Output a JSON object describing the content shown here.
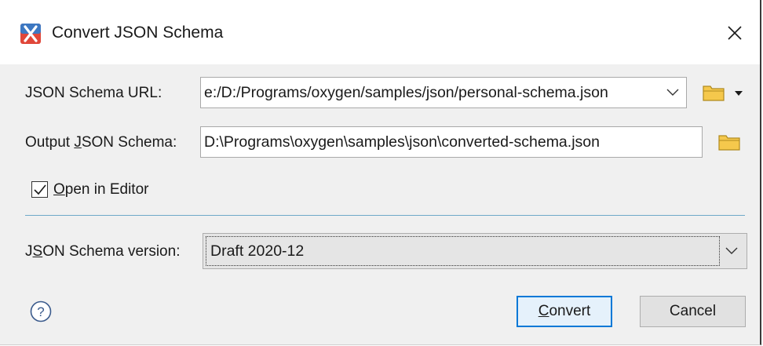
{
  "window": {
    "title": "Convert JSON Schema",
    "icon": "oxygen-x-icon",
    "close_icon": "close-icon"
  },
  "form": {
    "schema_url": {
      "label": "JSON Schema URL:",
      "value": "e:/D:/Programs/oxygen/samples/json/personal-schema.json"
    },
    "output": {
      "label_prefix": "Output ",
      "label_mnemonic": "J",
      "label_suffix": "SON Schema:",
      "value": "D:\\Programs\\oxygen\\samples\\json\\converted-schema.json"
    },
    "open_in_editor": {
      "label_mnemonic": "O",
      "label_rest": "pen in Editor",
      "checked": true
    },
    "version": {
      "label_prefix": "J",
      "label_mnemonic": "S",
      "label_suffix": "ON Schema version:",
      "selected": "Draft 2020-12"
    }
  },
  "buttons": {
    "convert_mnemonic": "C",
    "convert_rest": "onvert",
    "cancel": "Cancel"
  },
  "colors": {
    "accent": "#0078d7",
    "folder": "#f5c84c",
    "separator": "#6fa9c8",
    "app_icon": "#e0473a"
  }
}
